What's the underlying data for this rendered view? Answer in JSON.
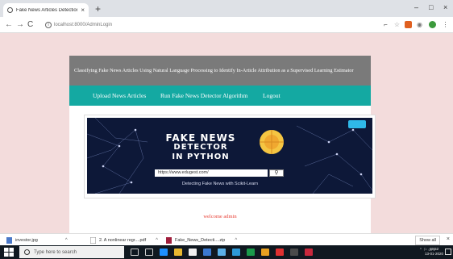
{
  "browser": {
    "tab_title": "Fake News Articles Detection Usi",
    "tab_close": "×",
    "new_tab": "+",
    "window_controls": {
      "minimize": "–",
      "maximize": "□",
      "close": "×"
    },
    "nav": {
      "back": "←",
      "forward": "→",
      "reload": "C"
    },
    "address": "localhost:8000/AdminLogin",
    "info_icon": "i"
  },
  "page": {
    "banner_title": "Classifying Fake News Articles Using Natural Language Processing to Identify In-Article Attribution as a Supervised Learning Estimator",
    "menu": [
      {
        "label": "Upload News Articles"
      },
      {
        "label": "Run Fake News Detector Algorithm"
      },
      {
        "label": "Logout"
      }
    ],
    "poster": {
      "title_line1": "FAKE NEWS",
      "title_line2": "DETECTOR",
      "title_line3": "IN PYTHON",
      "url": "https://www.edugest.com/",
      "caption": "Detecting Fake News with Scikit-Learn"
    },
    "welcome": "welcome admin"
  },
  "downloads": {
    "items": [
      {
        "name": "investor.jpg",
        "caret": "^"
      },
      {
        "name": "2. A nonlinear regr....pdf",
        "caret": "^"
      },
      {
        "name": "Fake_News_Detecti....zip",
        "caret": "^"
      }
    ],
    "show_all": "Show all",
    "close": "×"
  },
  "taskbar": {
    "search_placeholder": "Type here to search",
    "time": "19:52",
    "date": "13-01-2020"
  },
  "colors": {
    "menu_bg": "#14a9a2",
    "banner_bg": "#7a7a7a",
    "page_bg": "#f3dcdc",
    "welcome_text": "#e8443a"
  }
}
